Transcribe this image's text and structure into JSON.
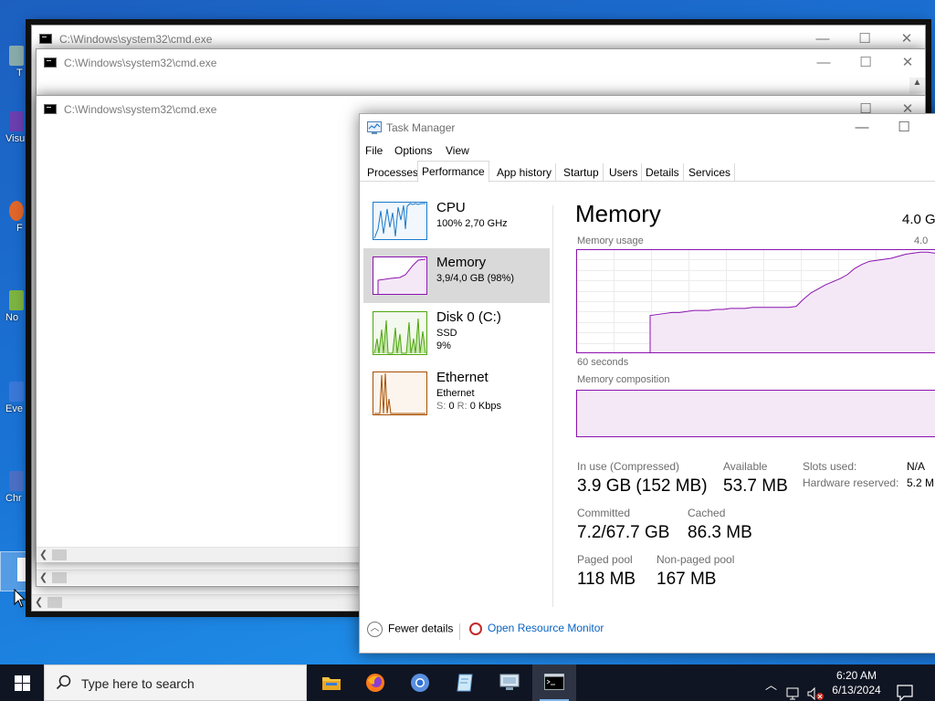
{
  "desktop": {
    "icons": [
      {
        "label": "T",
        "color": "#8aa"
      },
      {
        "label": "Visu",
        "color": "#6a3fb0"
      },
      {
        "label": "F",
        "color": "#e0662a"
      },
      {
        "label": "No",
        "color": "#7cb342"
      },
      {
        "label": "Eve",
        "color": "#3a78d8"
      },
      {
        "label": "Chr",
        "color": "#4a6fc4"
      }
    ]
  },
  "cmd_windows": [
    {
      "title": "C:\\Windows\\system32\\cmd.exe"
    },
    {
      "title": "C:\\Windows\\system32\\cmd.exe"
    },
    {
      "title": "C:\\Windows\\system32\\cmd.exe"
    }
  ],
  "task_manager": {
    "title": "Task Manager",
    "menu": [
      "File",
      "Options",
      "View"
    ],
    "tabs": [
      "Processes",
      "Performance",
      "App history",
      "Startup",
      "Users",
      "Details",
      "Services"
    ],
    "active_tab": "Performance",
    "resources": [
      {
        "name": "CPU",
        "line2": "100%  2,70 GHz",
        "line3": "",
        "color": "#1979ca"
      },
      {
        "name": "Memory",
        "line2": "3,9/4,0 GB (98%)",
        "line3": "",
        "color": "#8b12ae"
      },
      {
        "name": "Disk 0 (C:)",
        "line2": "SSD",
        "line3": "9%",
        "color": "#4da60c"
      },
      {
        "name": "Ethernet",
        "line2": "Ethernet",
        "line3_s": "S:",
        "line3_sv": "0",
        "line3_r": "R:",
        "line3_rv": "0 Kbps",
        "color": "#a74f01"
      }
    ],
    "detail": {
      "title": "Memory",
      "total": "4.0 G",
      "usage_label": "Memory usage",
      "usage_max": "4.0",
      "seconds_label": "60 seconds",
      "composition_label": "Memory composition",
      "stats": [
        {
          "label": "In use (Compressed)",
          "value": "3.9 GB (152 MB)"
        },
        {
          "label": "Available",
          "value": "53.7 MB"
        },
        {
          "label": "Committed",
          "value": "7.2/67.7 GB"
        },
        {
          "label": "Cached",
          "value": "86.3 MB"
        },
        {
          "label": "Paged pool",
          "value": "118 MB"
        },
        {
          "label": "Non-paged pool",
          "value": "167 MB"
        }
      ],
      "side_stats": [
        {
          "label": "Slots used:",
          "value": "N/A"
        },
        {
          "label": "Hardware reserved:",
          "value": "5.2 M"
        }
      ],
      "usage_series_fraction": [
        0.0,
        0.0,
        0.0,
        0.0,
        0.0,
        0.0,
        0.0,
        0.0,
        0.0,
        0.0,
        0.36,
        0.37,
        0.38,
        0.39,
        0.39,
        0.4,
        0.41,
        0.41,
        0.41,
        0.42,
        0.42,
        0.43,
        0.43,
        0.43,
        0.44,
        0.44,
        0.44,
        0.44,
        0.44,
        0.44,
        0.45,
        0.52,
        0.58,
        0.62,
        0.66,
        0.69,
        0.72,
        0.76,
        0.82,
        0.86,
        0.89,
        0.9,
        0.91,
        0.92,
        0.94,
        0.96,
        0.97,
        0.98,
        0.98,
        0.97,
        0.98,
        0.98
      ]
    },
    "footer": {
      "fewer_details": "Fewer details",
      "resource_monitor": "Open Resource Monitor"
    }
  },
  "taskbar": {
    "search_placeholder": "Type here to search",
    "time": "6:20 AM",
    "date": "6/13/2024"
  }
}
